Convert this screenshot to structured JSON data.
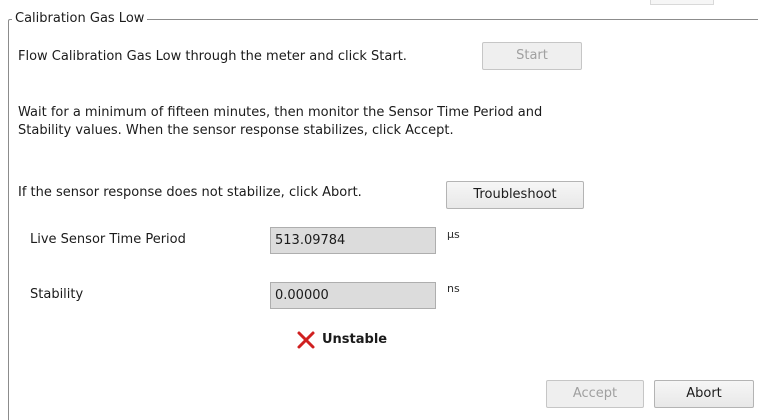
{
  "group": {
    "title": "Calibration Gas Low"
  },
  "instructions": {
    "flow_text": "Flow Calibration Gas Low through the meter and click Start.",
    "wait_text": "Wait for a minimum of fifteen minutes, then monitor the Sensor Time Period and Stability values. When the sensor response stabilizes, click Accept.",
    "abort_text": "If the sensor response does not stabilize, click Abort."
  },
  "buttons": {
    "start_label": "Start",
    "troubleshoot_label": "Troubleshoot",
    "accept_label": "Accept",
    "abort_label": "Abort"
  },
  "fields": {
    "sensor_time_period": {
      "label": "Live Sensor Time Period",
      "value": "513.09784",
      "unit": "µs"
    },
    "stability": {
      "label": "Stability",
      "value": "0.00000",
      "unit": "ns"
    }
  },
  "status": {
    "icon": "x-icon",
    "text": "Unstable",
    "color": "#d02020"
  }
}
